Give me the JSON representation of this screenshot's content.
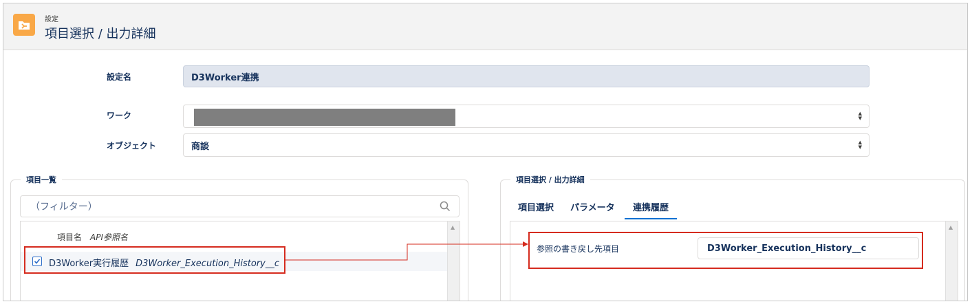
{
  "header": {
    "breadcrumb": "設定",
    "title": "項目選択 / 出力詳細"
  },
  "form": {
    "setting_name_label": "設定名",
    "setting_name_value": "D3Worker連携",
    "work_label": "ワーク",
    "object_label": "オブジェクト",
    "object_value": "商談"
  },
  "field_list": {
    "legend": "項目一覧",
    "filter_placeholder": "（フィルター）",
    "col_label": "項目名",
    "col_api": "API参照名",
    "rows": [
      {
        "label": "D3Worker実行履歴",
        "api": "D3Worker_Execution_History__c",
        "checked": true
      }
    ]
  },
  "detail": {
    "legend": "項目選択 / 出力詳細",
    "tabs": [
      {
        "label": "項目選択",
        "active": false
      },
      {
        "label": "パラメータ",
        "active": false
      },
      {
        "label": "連携履歴",
        "active": true
      }
    ],
    "writeback_label": "参照の書き戻し先項目",
    "writeback_value": "D3Worker_Execution_History__c"
  },
  "colors": {
    "header_icon": "#f9a847",
    "highlight": "#d52b1e",
    "active_tab": "#0070d2"
  }
}
